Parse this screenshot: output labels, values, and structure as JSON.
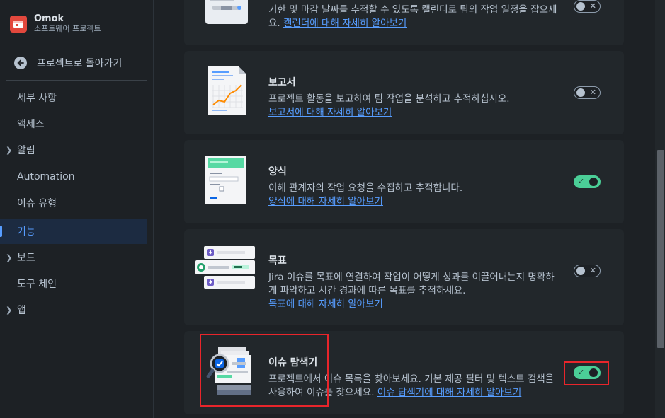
{
  "project": {
    "name": "Omok",
    "type": "소프트웨어 프로젝트"
  },
  "back_link": "프로젝트로 돌아가기",
  "nav": [
    {
      "label": "세부 사항",
      "chevron": false,
      "active": false
    },
    {
      "label": "액세스",
      "chevron": false,
      "active": false
    },
    {
      "label": "알림",
      "chevron": true,
      "active": false
    },
    {
      "label": "Automation",
      "chevron": false,
      "active": false
    },
    {
      "label": "이슈 유형",
      "chevron": false,
      "active": false
    },
    {
      "label": "기능",
      "chevron": false,
      "active": true
    },
    {
      "label": "보드",
      "chevron": true,
      "active": false
    },
    {
      "label": "도구 체인",
      "chevron": false,
      "active": false
    },
    {
      "label": "앱",
      "chevron": true,
      "active": false
    }
  ],
  "features": [
    {
      "title": "",
      "desc": "기한 및 마감 날짜를 추적할 수 있도록 캘린더로 팀의 작업 일정을 잡으세요.",
      "link": "캘린더에 대해 자세히 알아보기",
      "enabled": false,
      "icon": "calendar-icon"
    },
    {
      "title": "보고서",
      "desc": "프로젝트 활동을 보고하여 팀 작업을 분석하고 추적하십시오.",
      "link": "보고서에 대해 자세히 알아보기",
      "enabled": false,
      "icon": "report-chart-icon"
    },
    {
      "title": "양식",
      "desc": "이해 관계자의 작업 요청을 수집하고 추적합니다.",
      "link": "양식에 대해 자세히 알아보기",
      "enabled": true,
      "icon": "form-icon"
    },
    {
      "title": "목표",
      "desc": "Jira 이슈를 목표에 연결하여 작업이 어떻게 성과를 이끌어내는지 명확하게 파악하고 시간 경과에 따른 목표를 추적하세요.",
      "link": "목표에 대해 자세히 알아보기",
      "enabled": false,
      "icon": "goals-icon"
    },
    {
      "title": "이슈 탐색기",
      "desc": "프로젝트에서 이슈 목록을 찾아보세요. 기본 제공 필터 및 텍스트 검색을 사용하여 이슈를 찾으세요.",
      "link": "이슈 탐색기에 대해 자세히 알아보기",
      "enabled": true,
      "icon": "issue-navigator-icon"
    }
  ],
  "colors": {
    "accent": "#579dff",
    "toggle_on": "#4bce97",
    "highlight": "#e8252b"
  }
}
